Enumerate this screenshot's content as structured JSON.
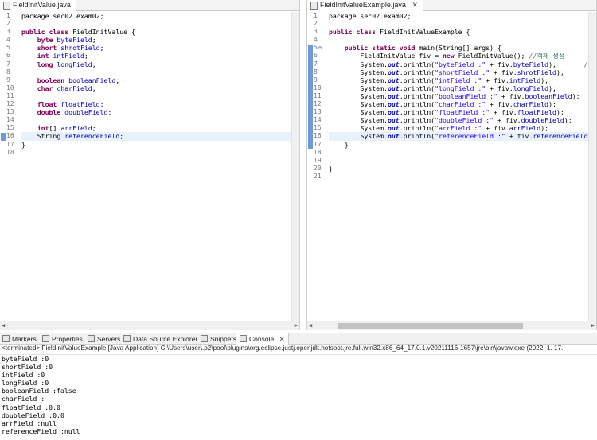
{
  "left_editor": {
    "tab_label": "FieldInitValue.java",
    "line_numbers": [
      "1",
      "2",
      "3",
      "4",
      "5",
      "6",
      "7",
      "8",
      "9",
      "10",
      "11",
      "12",
      "13",
      "14",
      "15",
      "16",
      "17",
      "18"
    ],
    "lines": [
      [
        {
          "t": "package sec02.exam02;",
          "c": "plain"
        }
      ],
      [],
      [
        {
          "t": "public class ",
          "c": "kw"
        },
        {
          "t": "FieldInitValue {",
          "c": "plain"
        }
      ],
      [
        {
          "t": "    byte ",
          "c": "kw"
        },
        {
          "t": "byteField",
          "c": "fld"
        },
        {
          "t": ";",
          "c": "plain"
        }
      ],
      [
        {
          "t": "    short ",
          "c": "kw"
        },
        {
          "t": "shrotField",
          "c": "fld"
        },
        {
          "t": ";",
          "c": "plain"
        }
      ],
      [
        {
          "t": "    int ",
          "c": "kw"
        },
        {
          "t": "intField",
          "c": "fld"
        },
        {
          "t": ";",
          "c": "plain"
        }
      ],
      [
        {
          "t": "    long ",
          "c": "kw"
        },
        {
          "t": "longField",
          "c": "fld"
        },
        {
          "t": ";",
          "c": "plain"
        }
      ],
      [],
      [
        {
          "t": "    boolean ",
          "c": "kw"
        },
        {
          "t": "booleanField",
          "c": "fld"
        },
        {
          "t": ";",
          "c": "plain"
        }
      ],
      [
        {
          "t": "    char ",
          "c": "kw"
        },
        {
          "t": "charField",
          "c": "fld"
        },
        {
          "t": ";",
          "c": "plain"
        }
      ],
      [],
      [
        {
          "t": "    float ",
          "c": "kw"
        },
        {
          "t": "floatField",
          "c": "fld"
        },
        {
          "t": ";",
          "c": "plain"
        }
      ],
      [
        {
          "t": "    double ",
          "c": "kw"
        },
        {
          "t": "doubleField",
          "c": "fld"
        },
        {
          "t": ";",
          "c": "plain"
        }
      ],
      [],
      [
        {
          "t": "    int",
          "c": "kw"
        },
        {
          "t": "[] ",
          "c": "plain"
        },
        {
          "t": "arrField",
          "c": "fld"
        },
        {
          "t": ";",
          "c": "plain"
        }
      ],
      [
        {
          "t": "    String ",
          "c": "plain"
        },
        {
          "t": "referenceField",
          "c": "fld"
        },
        {
          "t": ";",
          "c": "plain"
        }
      ],
      [
        {
          "t": "}",
          "c": "plain"
        }
      ],
      []
    ]
  },
  "right_editor": {
    "tab_label": "FieldInitValueExample.java",
    "line_numbers": [
      "1",
      "2",
      "3",
      "4",
      "5",
      "6",
      "7",
      "8",
      "9",
      "10",
      "11",
      "12",
      "13",
      "14",
      "15",
      "16",
      "17",
      "18",
      "19",
      "20",
      "21"
    ],
    "lines": [
      [
        {
          "t": "package sec02.exam02;",
          "c": "plain"
        }
      ],
      [],
      [
        {
          "t": "public class ",
          "c": "kw"
        },
        {
          "t": "FieldInitValueExample {",
          "c": "plain"
        }
      ],
      [],
      [
        {
          "t": "    public static void ",
          "c": "kw"
        },
        {
          "t": "main(String[] args) {",
          "c": "plain"
        }
      ],
      [
        {
          "t": "        FieldInitValue fiv = ",
          "c": "plain"
        },
        {
          "t": "new ",
          "c": "kw"
        },
        {
          "t": "FieldInitValue(); ",
          "c": "plain"
        },
        {
          "t": "//객체 생성",
          "c": "cmt"
        }
      ],
      [
        {
          "t": "        System.",
          "c": "plain"
        },
        {
          "t": "out",
          "c": "static"
        },
        {
          "t": ".println(",
          "c": "plain"
        },
        {
          "t": "\"byteField :\"",
          "c": "str"
        },
        {
          "t": " + fiv.",
          "c": "plain"
        },
        {
          "t": "byteField",
          "c": "fld"
        },
        {
          "t": ");       ",
          "c": "plain"
        },
        {
          "t": "//fiv.",
          "c": "cmt"
        }
      ],
      [
        {
          "t": "        System.",
          "c": "plain"
        },
        {
          "t": "out",
          "c": "static"
        },
        {
          "t": ".println(",
          "c": "plain"
        },
        {
          "t": "\"shortField :\"",
          "c": "str"
        },
        {
          "t": " + fiv.",
          "c": "plain"
        },
        {
          "t": "shrotField",
          "c": "fld"
        },
        {
          "t": ");",
          "c": "plain"
        }
      ],
      [
        {
          "t": "        System.",
          "c": "plain"
        },
        {
          "t": "out",
          "c": "static"
        },
        {
          "t": ".println(",
          "c": "plain"
        },
        {
          "t": "\"intField :\"",
          "c": "str"
        },
        {
          "t": " + fiv.",
          "c": "plain"
        },
        {
          "t": "intField",
          "c": "fld"
        },
        {
          "t": ");",
          "c": "plain"
        }
      ],
      [
        {
          "t": "        System.",
          "c": "plain"
        },
        {
          "t": "out",
          "c": "static"
        },
        {
          "t": ".println(",
          "c": "plain"
        },
        {
          "t": "\"longField :\"",
          "c": "str"
        },
        {
          "t": " + fiv.",
          "c": "plain"
        },
        {
          "t": "longField",
          "c": "fld"
        },
        {
          "t": ");",
          "c": "plain"
        }
      ],
      [
        {
          "t": "        System.",
          "c": "plain"
        },
        {
          "t": "out",
          "c": "static"
        },
        {
          "t": ".println(",
          "c": "plain"
        },
        {
          "t": "\"booleanField :\"",
          "c": "str"
        },
        {
          "t": " + fiv.",
          "c": "plain"
        },
        {
          "t": "booleanField",
          "c": "fld"
        },
        {
          "t": ");",
          "c": "plain"
        }
      ],
      [
        {
          "t": "        System.",
          "c": "plain"
        },
        {
          "t": "out",
          "c": "static"
        },
        {
          "t": ".println(",
          "c": "plain"
        },
        {
          "t": "\"charField :\"",
          "c": "str"
        },
        {
          "t": " + fiv.",
          "c": "plain"
        },
        {
          "t": "charField",
          "c": "fld"
        },
        {
          "t": ");",
          "c": "plain"
        }
      ],
      [
        {
          "t": "        System.",
          "c": "plain"
        },
        {
          "t": "out",
          "c": "static"
        },
        {
          "t": ".println(",
          "c": "plain"
        },
        {
          "t": "\"floatField :\"",
          "c": "str"
        },
        {
          "t": " + fiv.",
          "c": "plain"
        },
        {
          "t": "floatField",
          "c": "fld"
        },
        {
          "t": ");",
          "c": "plain"
        }
      ],
      [
        {
          "t": "        System.",
          "c": "plain"
        },
        {
          "t": "out",
          "c": "static"
        },
        {
          "t": ".println(",
          "c": "plain"
        },
        {
          "t": "\"doubleField :\"",
          "c": "str"
        },
        {
          "t": " + fiv.",
          "c": "plain"
        },
        {
          "t": "doubleField",
          "c": "fld"
        },
        {
          "t": ");",
          "c": "plain"
        }
      ],
      [
        {
          "t": "        System.",
          "c": "plain"
        },
        {
          "t": "out",
          "c": "static"
        },
        {
          "t": ".println(",
          "c": "plain"
        },
        {
          "t": "\"arrField :\"",
          "c": "str"
        },
        {
          "t": " + fiv.",
          "c": "plain"
        },
        {
          "t": "arrField",
          "c": "fld"
        },
        {
          "t": ");",
          "c": "plain"
        }
      ],
      [
        {
          "t": "        System.",
          "c": "plain"
        },
        {
          "t": "out",
          "c": "static"
        },
        {
          "t": ".println(",
          "c": "plain"
        },
        {
          "t": "\"referenceField :\"",
          "c": "str"
        },
        {
          "t": " + fiv.",
          "c": "plain"
        },
        {
          "t": "referenceField",
          "c": "fld"
        },
        {
          "t": ");",
          "c": "plain"
        }
      ],
      [
        {
          "t": "    }",
          "c": "plain"
        }
      ],
      [],
      [],
      [
        {
          "t": "}",
          "c": "plain"
        }
      ],
      []
    ]
  },
  "views": {
    "tabs": [
      "Markers",
      "Properties",
      "Servers",
      "Data Source Explorer",
      "Snippets",
      "Console"
    ],
    "active_tab": "Console"
  },
  "console": {
    "terminated_line": "<terminated> FieldInitValueExample [Java Application] C:\\Users\\user\\.p2\\pool\\plugins\\org.eclipse.justj.openjdk.hotspot.jre.full.win32.x86_64_17.0.1.v20211116-1657\\jre\\bin\\javaw.exe  (2022. 1. 17. ",
    "output": [
      "byteField :0",
      "shortField :0",
      "intField :0",
      "longField :0",
      "booleanField :false",
      "charField :",
      "floatField :0.0",
      "doubleField :0.0",
      "arrField :null",
      "referenceField :null"
    ]
  },
  "colors": {
    "keyword": "#7f0055",
    "field": "#0000c0",
    "string": "#2a00ff",
    "comment": "#3f7f5f",
    "current_line": "#e8f2fe",
    "ruler_marker": "#6d9bd8"
  }
}
